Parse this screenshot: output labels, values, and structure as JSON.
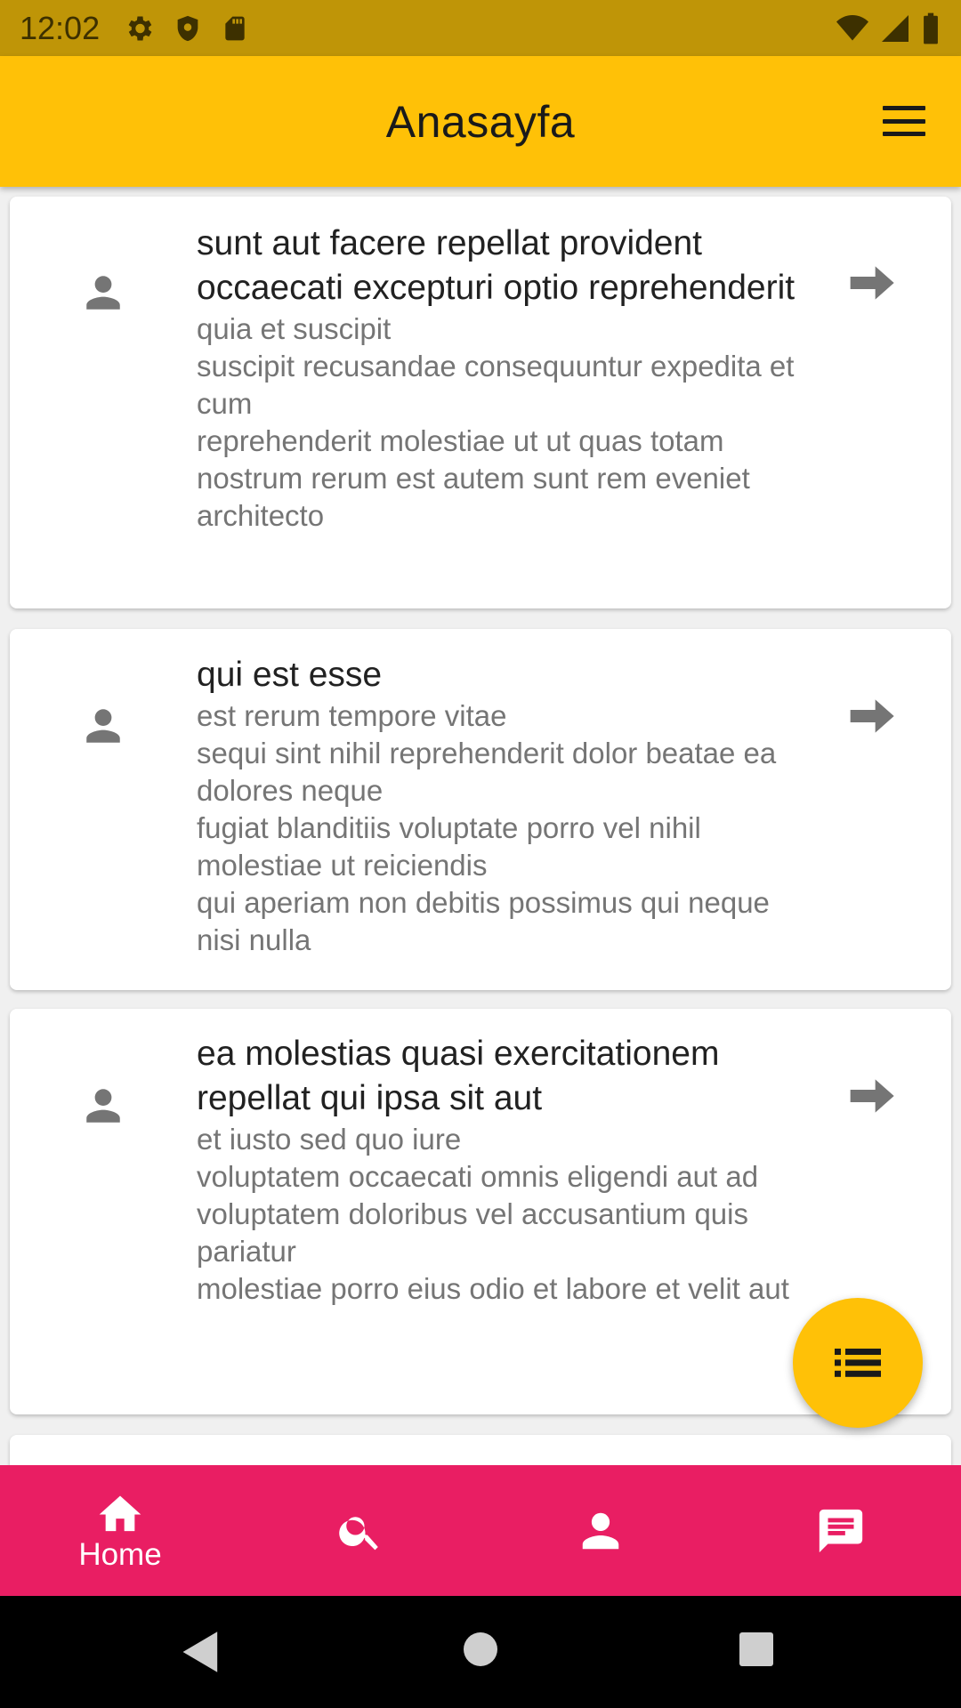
{
  "status_bar": {
    "time": "12:02",
    "left_icons": [
      "gear-icon",
      "shield-icon",
      "sd-card-icon"
    ],
    "right_icons": [
      "wifi-icon",
      "signal-icon",
      "battery-icon"
    ]
  },
  "app_bar": {
    "title": "Anasayfa",
    "menu_icon": "menu-icon",
    "color": "#ffc107"
  },
  "posts": [
    {
      "title": "sunt aut facere repellat provident occaecati excepturi optio reprehenderit",
      "body": "quia et suscipit\nsuscipit recusandae consequuntur expedita et cum\nreprehenderit molestiae ut ut quas totam\nnostrum rerum est autem sunt rem eveniet architecto"
    },
    {
      "title": "qui est esse",
      "body": "est rerum tempore vitae\nsequi sint nihil reprehenderit dolor beatae ea dolores neque\nfugiat blanditiis voluptate porro vel nihil molestiae ut reiciendis\nqui aperiam non debitis possimus qui neque nisi nulla"
    },
    {
      "title": "ea molestias quasi exercitationem repellat qui ipsa sit aut",
      "body": "et iusto sed quo iure\nvoluptatem occaecati omnis eligendi aut ad\nvoluptatem doloribus vel accusantium quis pariatur\nmolestiae porro eius odio et labore et velit aut"
    }
  ],
  "fab": {
    "icon": "list-icon"
  },
  "bottom_nav": {
    "color": "#e91e63",
    "items": [
      {
        "icon": "home-icon",
        "label": "Home",
        "active": true
      },
      {
        "icon": "search-icon",
        "label": "",
        "active": false
      },
      {
        "icon": "person-icon",
        "label": "",
        "active": false
      },
      {
        "icon": "chat-icon",
        "label": "",
        "active": false
      }
    ]
  },
  "system_nav": [
    "back-icon",
    "home-circle-icon",
    "recents-icon"
  ]
}
